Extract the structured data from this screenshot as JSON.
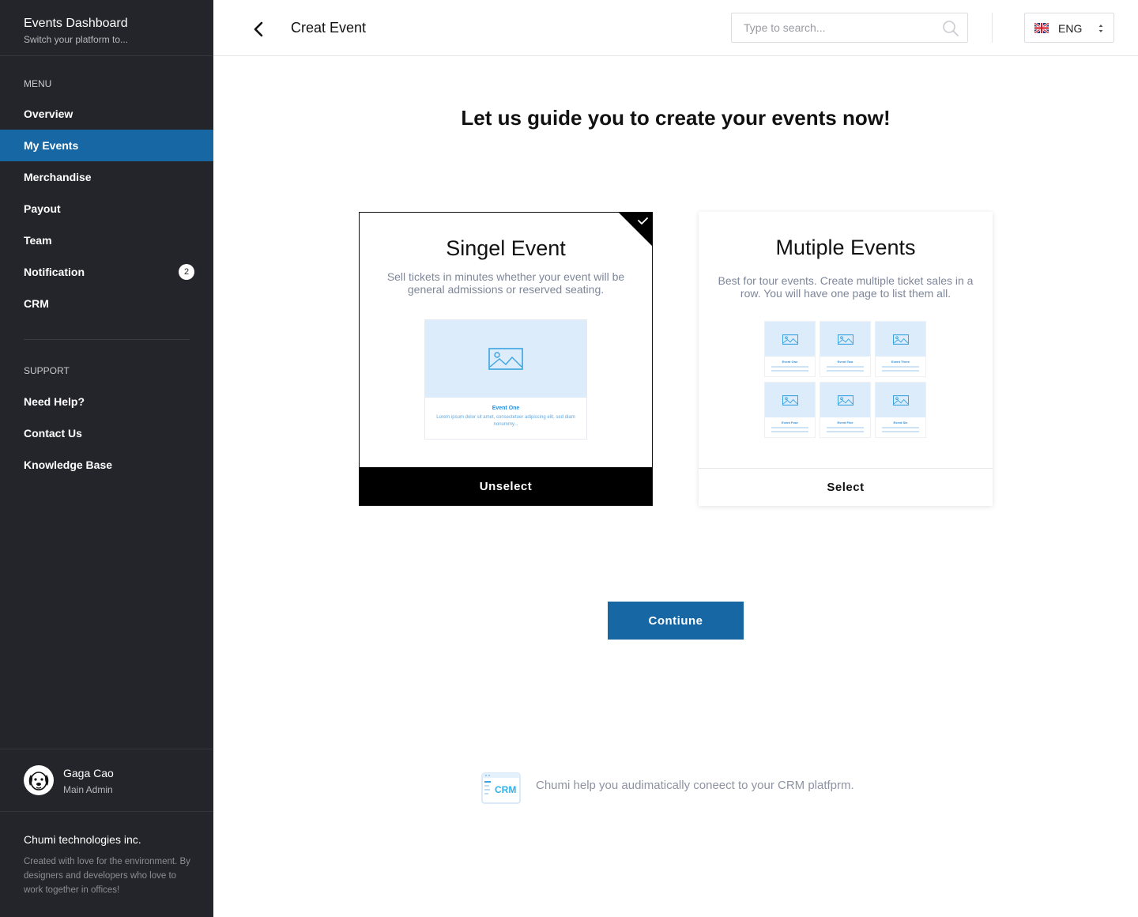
{
  "sidebar": {
    "title": "Events Dashboard",
    "subtitle": "Switch your platform to...",
    "menu_label": "MENU",
    "menu": [
      {
        "label": "Overview"
      },
      {
        "label": "My Events"
      },
      {
        "label": "Merchandise"
      },
      {
        "label": "Payout"
      },
      {
        "label": "Team"
      },
      {
        "label": "Notification",
        "badge": "2"
      },
      {
        "label": "CRM"
      }
    ],
    "active_item": "My Events",
    "support_label": "SUPPORT",
    "support": [
      {
        "label": "Need Help?"
      },
      {
        "label": "Contact Us"
      },
      {
        "label": "Knowledge Base"
      }
    ],
    "user": {
      "name": "Gaga Cao",
      "role": "Main Admin",
      "avatar_icon": "dog-avatar-icon"
    },
    "company": "Chumi technologies inc.",
    "footnote": "Created with love for the environment. By designers and developers who love to work together in offices!"
  },
  "topbar": {
    "title": "Creat Event",
    "search_placeholder": "Type to search...",
    "language": "ENG"
  },
  "main": {
    "heading": "Let us guide you to create your events now!",
    "cards": [
      {
        "title": "Singel Event",
        "description": "Sell tickets in minutes whether your event will be general admissions or reserved seating.",
        "button": "Unselect",
        "selected": true,
        "preview": {
          "name": "Event One",
          "text": "Lorem ipsum dolor sit amet, consectetuer adipiscing elit, sed diam nonummy..."
        }
      },
      {
        "title": "Mutiple Events",
        "description": "Best for tour events. Create multiple ticket sales in a row. You will have one page to list them all.",
        "button": "Select",
        "selected": false,
        "preview": {
          "names": [
            "Event One",
            "Event Two",
            "Event Three",
            "Event Four",
            "Event Five",
            "Event Six"
          ]
        }
      }
    ],
    "continue": "Contiune",
    "crm_logo_text": "CRM",
    "crm_text": "Chumi help you audimatically coneect to your CRM platfprm."
  },
  "colors": {
    "sidebar_bg": "#24252a",
    "accent": "#1767a5",
    "preview_blue": "#dcecfb",
    "muted_text": "#7e8799"
  }
}
